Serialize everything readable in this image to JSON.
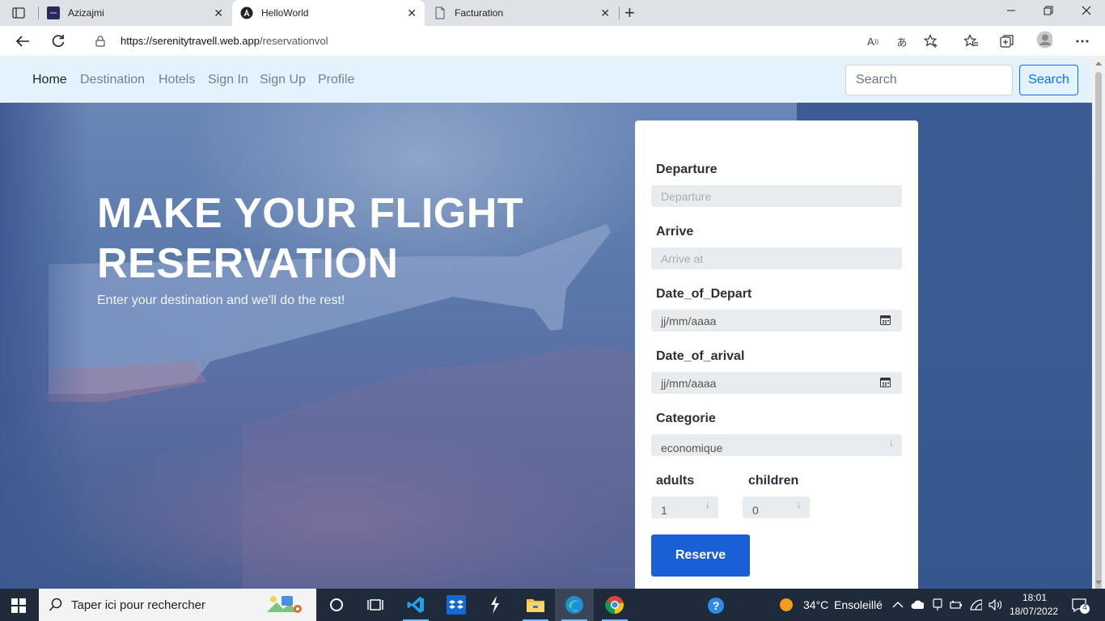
{
  "browser": {
    "tabs": [
      {
        "title": "Azizajmi",
        "active": false
      },
      {
        "title": "HelloWorld",
        "active": true
      },
      {
        "title": "Facturation",
        "active": false
      }
    ],
    "url_host": "https://serenitytravell.web.app",
    "url_path": "/reservationvol"
  },
  "nav": {
    "links": [
      "Home",
      "Destination",
      "Hotels",
      "Sign In",
      "Sign Up",
      "Profile"
    ],
    "search_placeholder": "Search",
    "search_button": "Search"
  },
  "hero": {
    "title": "MAKE YOUR FLIGHT RESERVATION",
    "subtitle": "Enter your destination and we'll do the rest!"
  },
  "form": {
    "departure_label": "Departure",
    "departure_placeholder": "Departure",
    "arrive_label": "Arrive",
    "arrive_placeholder": "Arrive at",
    "date_depart_label": "Date_of_Depart",
    "date_depart_value": "jj/mm/aaaa",
    "date_arrival_label": "Date_of_arival",
    "date_arrival_value": "jj/mm/aaaa",
    "category_label": "Categorie",
    "category_value": "economique",
    "adults_label": "adults",
    "adults_value": "1",
    "children_label": "children",
    "children_value": "0",
    "reserve_button": "Reserve"
  },
  "taskbar": {
    "search_placeholder": "Taper ici pour rechercher",
    "weather_temp": "34°C",
    "weather_desc": "Ensoleillé",
    "time": "18:01",
    "date": "18/07/2022",
    "notifications": "4"
  },
  "colors": {
    "navbar_bg": "#e3f2fd",
    "primary": "#1a5fd6",
    "search_outline": "#0d6efd",
    "taskbar_bg": "#1f2a3a"
  }
}
